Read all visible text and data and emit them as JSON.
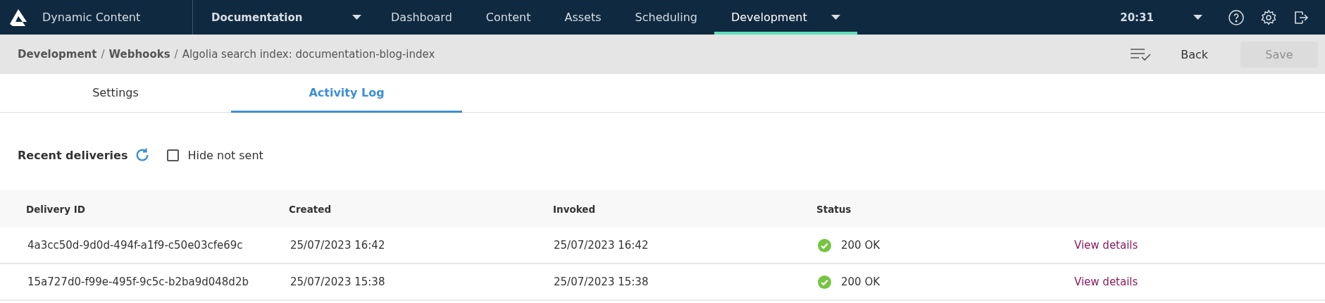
{
  "topbar": {
    "app_name": "Dynamic Content",
    "hub": {
      "label": "Documentation"
    },
    "nav": [
      {
        "label": "Dashboard",
        "selected": false,
        "dropdown": false
      },
      {
        "label": "Content",
        "selected": false,
        "dropdown": false
      },
      {
        "label": "Assets",
        "selected": false,
        "dropdown": false
      },
      {
        "label": "Scheduling",
        "selected": false,
        "dropdown": false
      },
      {
        "label": "Development",
        "selected": true,
        "dropdown": true
      }
    ],
    "clock": "20:31"
  },
  "breadcrumb": {
    "separator": "/",
    "items": [
      {
        "label": "Development",
        "bold": true
      },
      {
        "label": "Webhooks",
        "bold": true
      },
      {
        "label": "Algolia search index: documentation-blog-index",
        "bold": false
      }
    ],
    "back": "Back",
    "save": {
      "label": "Save",
      "disabled": true
    }
  },
  "tabs": [
    {
      "label": "Settings",
      "selected": false
    },
    {
      "label": "Activity Log",
      "selected": true
    }
  ],
  "deliveries": {
    "title": "Recent deliveries",
    "filter": {
      "label": "Hide not sent",
      "checked": false
    }
  },
  "table": {
    "columns": [
      "Delivery ID",
      "Created",
      "Invoked",
      "Status"
    ],
    "rows": [
      {
        "id": "4a3cc50d-9d0d-494f-a1f9-c50e03cfe69c",
        "created": "25/07/2023 16:42",
        "invoked": "25/07/2023 16:42",
        "status": {
          "kind": "success",
          "text": "200 OK"
        },
        "link": "View details"
      },
      {
        "id": "15a727d0-f99e-495f-9c5c-b2ba9d048d2b",
        "created": "25/07/2023 15:38",
        "invoked": "25/07/2023 15:38",
        "status": {
          "kind": "success",
          "text": "200 OK"
        },
        "link": "View details"
      }
    ]
  }
}
